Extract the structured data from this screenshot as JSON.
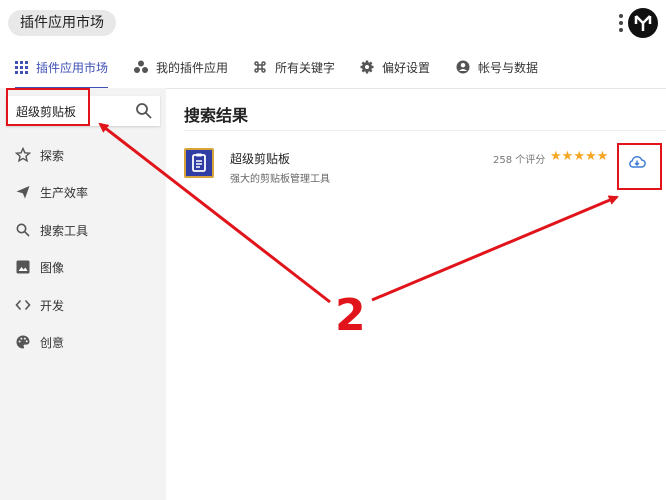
{
  "window": {
    "title": "插件应用市场"
  },
  "tabs": [
    {
      "label": "插件应用市场",
      "icon": "grid-icon"
    },
    {
      "label": "我的插件应用",
      "icon": "bubbles-icon"
    },
    {
      "label": "所有关键字",
      "icon": "command-icon"
    },
    {
      "label": "偏好设置",
      "icon": "gear-icon"
    },
    {
      "label": "帐号与数据",
      "icon": "account-icon"
    }
  ],
  "sidebar": {
    "search_value": "超级剪贴板",
    "items": [
      {
        "label": "探索",
        "icon": "star-outline-icon"
      },
      {
        "label": "生产效率",
        "icon": "send-icon"
      },
      {
        "label": "搜索工具",
        "icon": "search-icon"
      },
      {
        "label": "图像",
        "icon": "image-icon"
      },
      {
        "label": "开发",
        "icon": "code-icon"
      },
      {
        "label": "创意",
        "icon": "palette-icon"
      }
    ]
  },
  "main": {
    "heading": "搜索结果",
    "results": [
      {
        "name": "超级剪贴板",
        "description": "强大的剪贴板管理工具",
        "ratings": "258 个评分",
        "stars": 5
      }
    ]
  },
  "annotation": {
    "step": "2",
    "color": "#e0141a"
  },
  "colors": {
    "accent": "#3f51b5",
    "sidebar_bg": "#f3f3f3",
    "star": "#f5a623"
  }
}
